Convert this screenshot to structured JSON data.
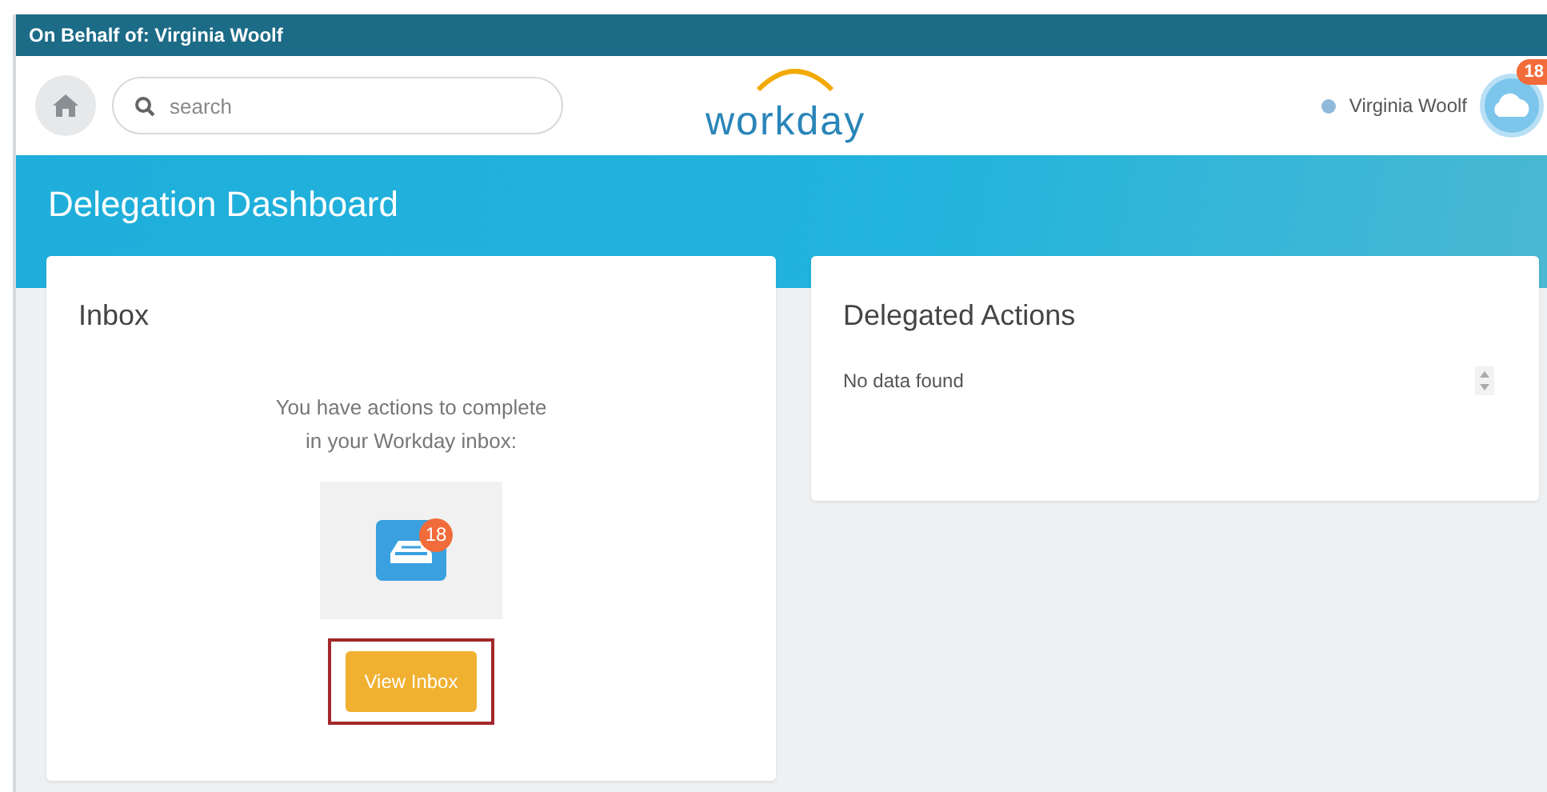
{
  "delegate_bar": {
    "text": "On Behalf of: Virginia Woolf"
  },
  "header": {
    "search": {
      "placeholder": "search"
    },
    "logo": "workday",
    "user": {
      "name": "Virginia Woolf",
      "badge": "18"
    }
  },
  "page_title": "Delegation Dashboard",
  "inbox_card": {
    "title": "Inbox",
    "message_lines": [
      "You have actions to complete",
      "in your Workday inbox:"
    ],
    "inbox_badge": "18",
    "button": {
      "label": "View Inbox",
      "highlighted": true
    }
  },
  "delegated_card": {
    "title": "Delegated Actions",
    "empty_text": "No data found"
  }
}
